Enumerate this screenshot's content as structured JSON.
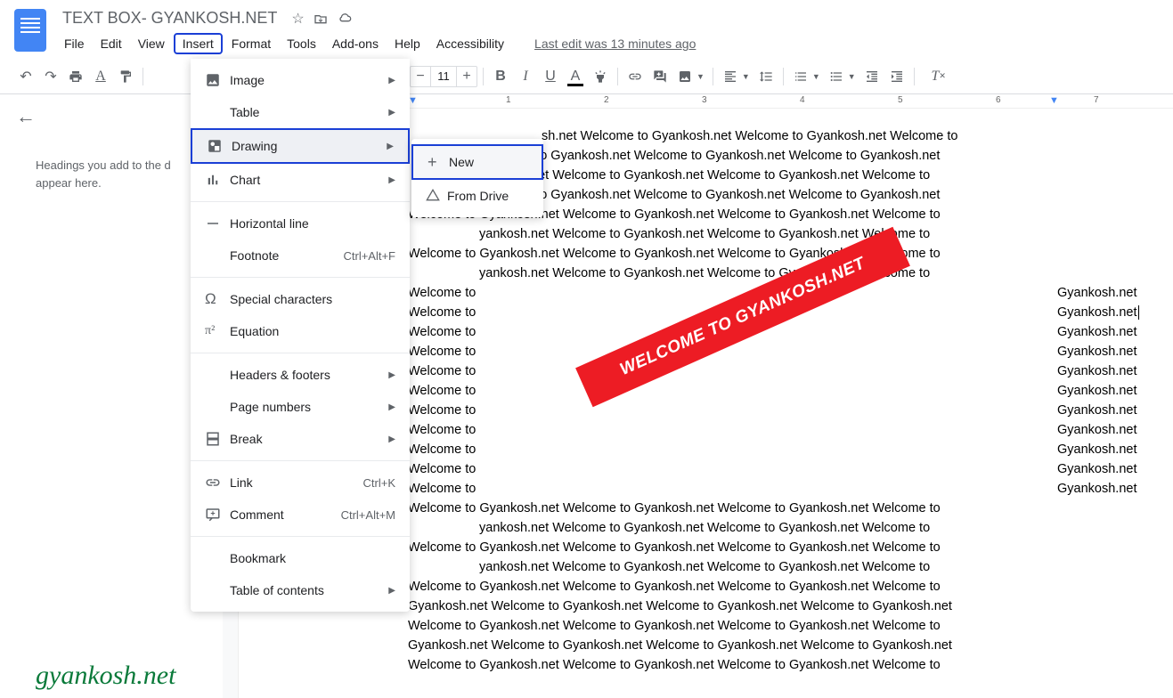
{
  "header": {
    "title": "TEXT BOX- GYANKOSH.NET",
    "menu": [
      "File",
      "Edit",
      "View",
      "Insert",
      "Format",
      "Tools",
      "Add-ons",
      "Help",
      "Accessibility"
    ],
    "active_menu_index": 3,
    "last_edit": "Last edit was 13 minutes ago"
  },
  "toolbar": {
    "font_size": "11"
  },
  "ruler": {
    "marks": [
      "1",
      "2",
      "3",
      "4",
      "5",
      "6",
      "7"
    ]
  },
  "outline": {
    "text": "Headings you add to the d\nappear here."
  },
  "insert_menu": {
    "items": [
      {
        "icon": "image",
        "label": "Image",
        "arrow": true
      },
      {
        "icon": "table",
        "label": "Table",
        "arrow": true
      },
      {
        "icon": "drawing",
        "label": "Drawing",
        "arrow": true,
        "highlighted": true
      },
      {
        "icon": "chart",
        "label": "Chart",
        "arrow": true
      },
      {
        "sep": true
      },
      {
        "icon": "hr",
        "label": "Horizontal line"
      },
      {
        "icon": "",
        "label": "Footnote",
        "shortcut": "Ctrl+Alt+F"
      },
      {
        "sep": true
      },
      {
        "icon": "omega",
        "label": "Special characters"
      },
      {
        "icon": "pi",
        "label": "Equation"
      },
      {
        "sep": true
      },
      {
        "icon": "",
        "label": "Headers & footers",
        "arrow": true
      },
      {
        "icon": "",
        "label": "Page numbers",
        "arrow": true
      },
      {
        "icon": "break",
        "label": "Break",
        "arrow": true
      },
      {
        "sep": true
      },
      {
        "icon": "link",
        "label": "Link",
        "shortcut": "Ctrl+K"
      },
      {
        "icon": "comment",
        "label": "Comment",
        "shortcut": "Ctrl+Alt+M"
      },
      {
        "sep": true
      },
      {
        "icon": "",
        "label": "Bookmark"
      },
      {
        "icon": "",
        "label": "Table of contents",
        "arrow": true
      }
    ]
  },
  "submenu": {
    "items": [
      {
        "icon": "+",
        "label": "New",
        "highlighted": true
      },
      {
        "icon": "drive",
        "label": "From Drive"
      }
    ]
  },
  "document": {
    "phrase": "Welcome to Gyankosh.net",
    "welcome": "Welcome to",
    "site": "Gyankosh.net",
    "line_partial_start": "sh.net Welcome to Gyankosh.net Welcome to Gyankosh.net Welcome to",
    "line_mid_a": "me to Gyankosh.net Welcome to Gyankosh.net Welcome to Gyankosh.net",
    "line_mid_b": "yankosh.net Welcome to Gyankosh.net Welcome to Gyankosh.net Welcome to",
    "line_full_a": "Welcome to Gyankosh.net Welcome to Gyankosh.net Welcome to Gyankosh.net Welcome to",
    "line_full_b": "Gyankosh.net Welcome to Gyankosh.net Welcome to Gyankosh.net Welcome to Gyankosh.net",
    "split_left": "Welcome to",
    "split_right": "Gyankosh.net",
    "ribbon_text": "WELCOME TO GYANKOSH.NET"
  },
  "watermark": "gyankosh.net"
}
